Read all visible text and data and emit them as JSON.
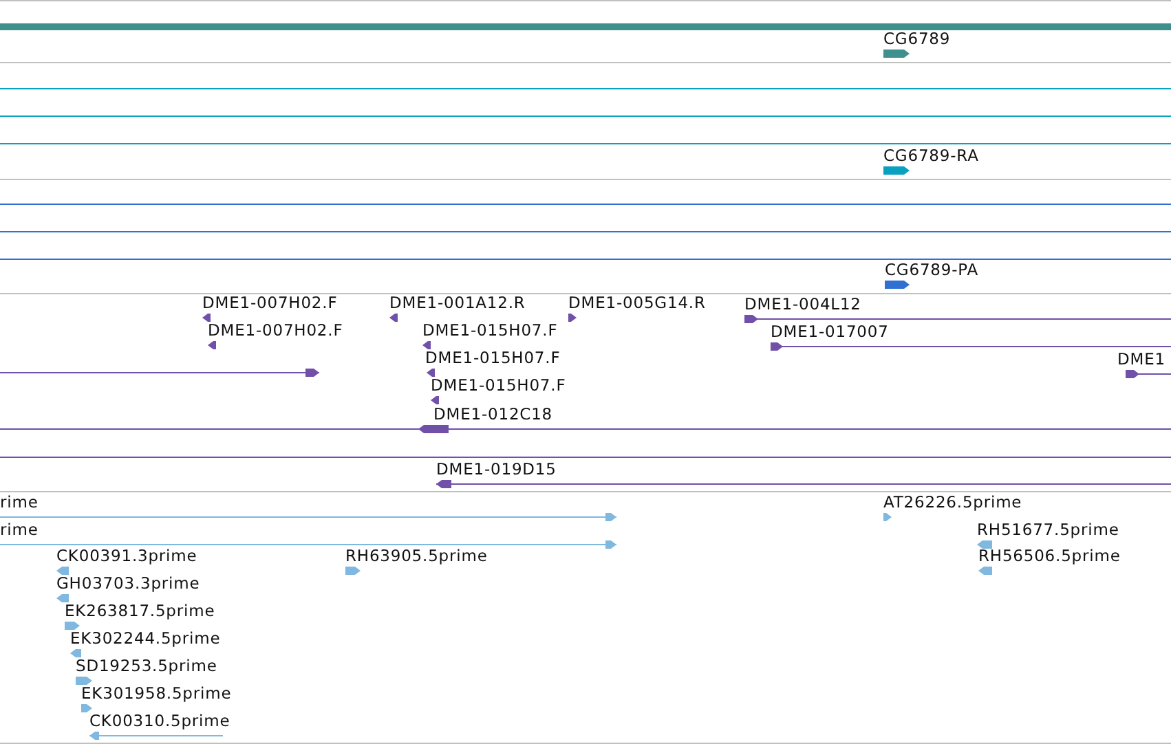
{
  "tracks": [
    {
      "color": "#3f8f8f",
      "features": [
        {
          "kind": "bar"
        },
        {
          "kind": "block",
          "label": "CG6789",
          "reverse": false
        }
      ]
    },
    {
      "color": "#0aa0c0",
      "features": [
        {
          "kind": "span"
        },
        {
          "kind": "span"
        },
        {
          "kind": "span"
        },
        {
          "kind": "block",
          "label": "CG6789-RA",
          "reverse": false
        }
      ]
    },
    {
      "color": "#3070d0",
      "features": [
        {
          "kind": "span"
        },
        {
          "kind": "span"
        },
        {
          "kind": "span"
        },
        {
          "kind": "block",
          "label": "CG6789-PA",
          "reverse": false
        }
      ]
    },
    {
      "color": "#7050a8",
      "features": [
        {
          "kind": "block",
          "label": "DME1-007H02.F",
          "reverse": true
        },
        {
          "kind": "block",
          "label": "DME1-001A12.R",
          "reverse": true
        },
        {
          "kind": "block",
          "label": "DME1-005G14.R",
          "reverse": false
        },
        {
          "kind": "line",
          "label": "DME1-004L12",
          "reverse": false
        },
        {
          "kind": "block",
          "label": "DME1-007H02.F",
          "reverse": true
        },
        {
          "kind": "block",
          "label": "DME1-015H07.F",
          "reverse": true
        },
        {
          "kind": "line",
          "label": "DME1-017007",
          "reverse": false
        },
        {
          "kind": "line",
          "reverse": false
        },
        {
          "kind": "block",
          "label": "DME1-015H07.F",
          "reverse": true
        },
        {
          "kind": "line",
          "label": "DME1",
          "reverse": false
        },
        {
          "kind": "block",
          "label": "DME1-015H07.F",
          "reverse": true
        },
        {
          "kind": "line",
          "label": "DME1-012C18",
          "reverse": true
        },
        {
          "kind": "span"
        },
        {
          "kind": "line",
          "label": "DME1-019D15",
          "reverse": true
        }
      ]
    },
    {
      "color": "#80b8e0",
      "features": [
        {
          "kind": "line",
          "label": "rime",
          "reverse": false
        },
        {
          "kind": "block",
          "label": "AT26226.5prime",
          "reverse": false
        },
        {
          "kind": "line",
          "label": "rime",
          "reverse": false
        },
        {
          "kind": "block",
          "label": "RH51677.5prime",
          "reverse": true
        },
        {
          "kind": "block",
          "label": "CK00391.3prime",
          "reverse": true
        },
        {
          "kind": "block",
          "label": "RH63905.5prime",
          "reverse": false
        },
        {
          "kind": "block",
          "label": "RH56506.5prime",
          "reverse": true
        },
        {
          "kind": "block",
          "label": "GH03703.3prime",
          "reverse": true
        },
        {
          "kind": "block",
          "label": "EK263817.5prime",
          "reverse": false
        },
        {
          "kind": "block",
          "label": "EK302244.5prime",
          "reverse": true
        },
        {
          "kind": "block",
          "label": "SD19253.5prime",
          "reverse": false
        },
        {
          "kind": "block",
          "label": "EK301958.5prime",
          "reverse": false
        },
        {
          "kind": "line",
          "label": "CK00310.5prime",
          "reverse": true
        }
      ]
    }
  ]
}
